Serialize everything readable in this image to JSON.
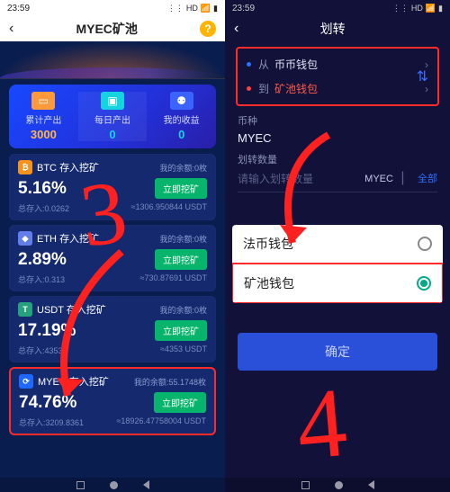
{
  "status": {
    "time": "23:59",
    "icons": [
      "HD",
      "▮▮▮"
    ]
  },
  "left": {
    "title": "MYEC矿池",
    "stats": [
      {
        "icon": "wallet",
        "label": "累计产出",
        "value": "3000"
      },
      {
        "icon": "box",
        "label": "每日产出",
        "value": "0"
      },
      {
        "icon": "user",
        "label": "我的收益",
        "value": "0"
      }
    ],
    "deposit_suffix": "存入挖矿",
    "balance_prefix": "我的余额:",
    "balance_suffix": "枚",
    "total_prefix": "总存入:",
    "btn": "立即挖矿",
    "coins": [
      {
        "sym": "BTC",
        "rate": "5.16%",
        "bal": "0",
        "total": "0.0262",
        "usdt": "≈1306.950844 USDT"
      },
      {
        "sym": "ETH",
        "rate": "2.89%",
        "bal": "0",
        "total": "0.313",
        "usdt": "≈730.87691 USDT"
      },
      {
        "sym": "USDT",
        "rate": "17.19%",
        "bal": "0",
        "total": "4353",
        "usdt": "≈4353 USDT"
      },
      {
        "sym": "MYEC",
        "rate": "74.76%",
        "bal": "55.1748",
        "total": "3209.8361",
        "usdt": "≈18926.47758004 USDT"
      }
    ]
  },
  "right": {
    "title": "划转",
    "from_label": "从",
    "from_value": "币币钱包",
    "to_label": "到",
    "to_value": "矿池钱包",
    "currency_label": "币种",
    "currency_value": "MYEC",
    "amount_label": "划转数量",
    "amount_placeholder": "请输入划转数量",
    "amount_unit": "MYEC",
    "all": "全部",
    "sheet": {
      "opt1": "法币钱包",
      "opt2": "矿池钱包"
    },
    "confirm": "确定"
  },
  "annotations": {
    "step_left": "3",
    "step_right": "4"
  }
}
